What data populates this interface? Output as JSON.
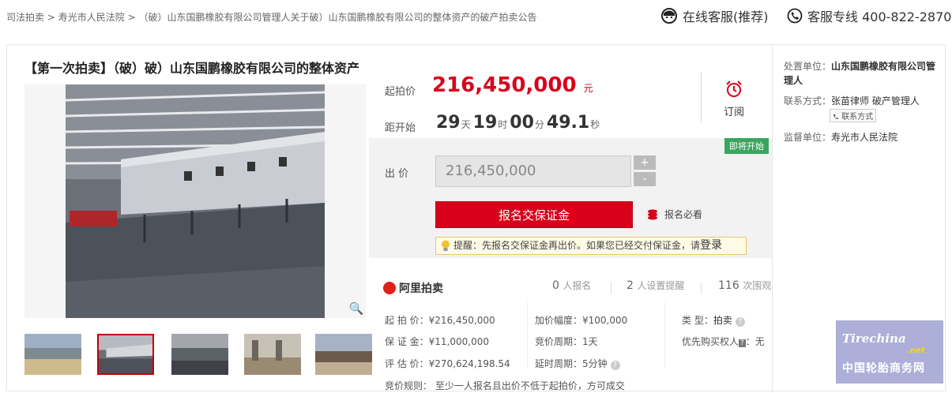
{
  "breadcrumb": [
    "司法拍卖",
    ">",
    "寿光市人民法院",
    ">",
    "（破）山东国鹏橡胶有限公司管理人关于破）山东国鹏橡胶有限公司的整体资产的破产拍卖公告"
  ],
  "header": {
    "online_service": "在线客服(推荐)",
    "hotline": "客服专线 400-822-2870"
  },
  "auction": {
    "title": "【第一次拍卖】（破）破）山东国鹏橡胶有限公司的整体资产",
    "start_price_label": "起拍价",
    "start_price": "216,450,000",
    "currency_unit": "元",
    "countdown_label": "距开始",
    "countdown": {
      "days": "29",
      "days_unit": "天",
      "hours": "19",
      "hours_unit": "时",
      "minutes": "00",
      "minutes_unit": "分",
      "seconds": "49.1",
      "seconds_unit": "秒"
    },
    "subscribe_label": "订阅",
    "soon_tag": "即将开始",
    "bid_label": "出  价",
    "bid_value": "216,450,000",
    "plus": "+",
    "minus": "-",
    "register_button": "报名交保证金",
    "must_read": "报名必看",
    "tip_text": "提醒：先报名交保证金再出价。如果您已经交付保证金，请",
    "tip_login": "登录"
  },
  "stats": {
    "brand": "阿里拍卖",
    "signups": "0",
    "signups_label": "人报名",
    "reminders": "2",
    "reminders_label": "人设置提醒",
    "views": "116",
    "views_label": "次围观"
  },
  "details": {
    "start_price": "起 拍 价：¥216,450,000",
    "deposit": "保 证 金：¥11,000,000",
    "valuation": "评 估 价：¥270,624,198.54",
    "increment": "加价幅度：¥100,000",
    "cycle": "竞价周期：1天",
    "extension": "延时周期：5分钟",
    "type_label": "类    型：",
    "type_value": "拍卖",
    "priority_label": "优先购买权人",
    "priority_badge": "?",
    "priority_value": "：无",
    "rule": "竞价规则：  至少一人报名且出价不低于起拍价，方可成交"
  },
  "sidebar": {
    "unit_label": "处置单位：",
    "unit_value": "山东国鹏橡胶有限公司管理人",
    "contact_label": "联系方式：",
    "contact_value": "张苗律师 破产管理人",
    "contact_chip": "联系方式",
    "supervisor_label": "监督单位：",
    "supervisor_value": "寿光市人民法院"
  },
  "watermark": {
    "brand": "Tirechina",
    "suffix": ".net",
    "cn": "中国轮胎商务网"
  },
  "colors": {
    "accent": "#d9001b",
    "soon": "#3aa55d"
  }
}
